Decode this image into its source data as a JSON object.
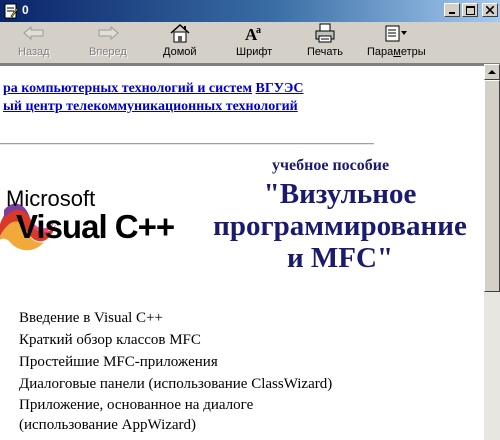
{
  "window": {
    "title": "0",
    "icon": "document-edit-icon",
    "controls": [
      "minimize-icon",
      "maximize-icon",
      "close-icon"
    ]
  },
  "toolbar": {
    "buttons": [
      {
        "label": "Назад",
        "icon": "back-arrow-icon",
        "enabled": false
      },
      {
        "label": "Вперед",
        "icon": "forward-arrow-icon",
        "enabled": false
      },
      {
        "label": "Домой",
        "icon": "home-icon",
        "enabled": true
      },
      {
        "label": "Шрифт",
        "icon": "font-icon",
        "enabled": true
      },
      {
        "label": "Печать",
        "icon": "printer-icon",
        "enabled": true
      },
      {
        "label": "Параметры",
        "icon": "options-icon",
        "enabled": true,
        "underlined_char": "м"
      }
    ]
  },
  "content": {
    "header": {
      "line1_text": "ра компьютерных технологий и систем",
      "line1_link": "ВГУЭС",
      "line2_text": "ый центр телекоммуникационных технологий"
    },
    "logo": {
      "line1": "Microsoft",
      "line2": "Visual C++"
    },
    "subtitle": "учебное пособие",
    "title_lines": [
      "\"Визульное",
      "программирование",
      "и MFC\""
    ],
    "toc": [
      "Введение в Visual C++",
      "Краткий обзор классов MFC",
      "Простейшие MFC-приложения",
      "Диалоговые панели (использование ClassWizard)",
      "Приложение, основанное на диалоге",
      "(использование AppWizard)"
    ],
    "colors": {
      "link": "#0000cc",
      "title": "#1a1a6e",
      "titlebar_start": "#0a246a",
      "titlebar_end": "#a6caf0"
    }
  },
  "scrollbar": {
    "position_fraction": 0.0,
    "visible_fraction": 0.56
  }
}
